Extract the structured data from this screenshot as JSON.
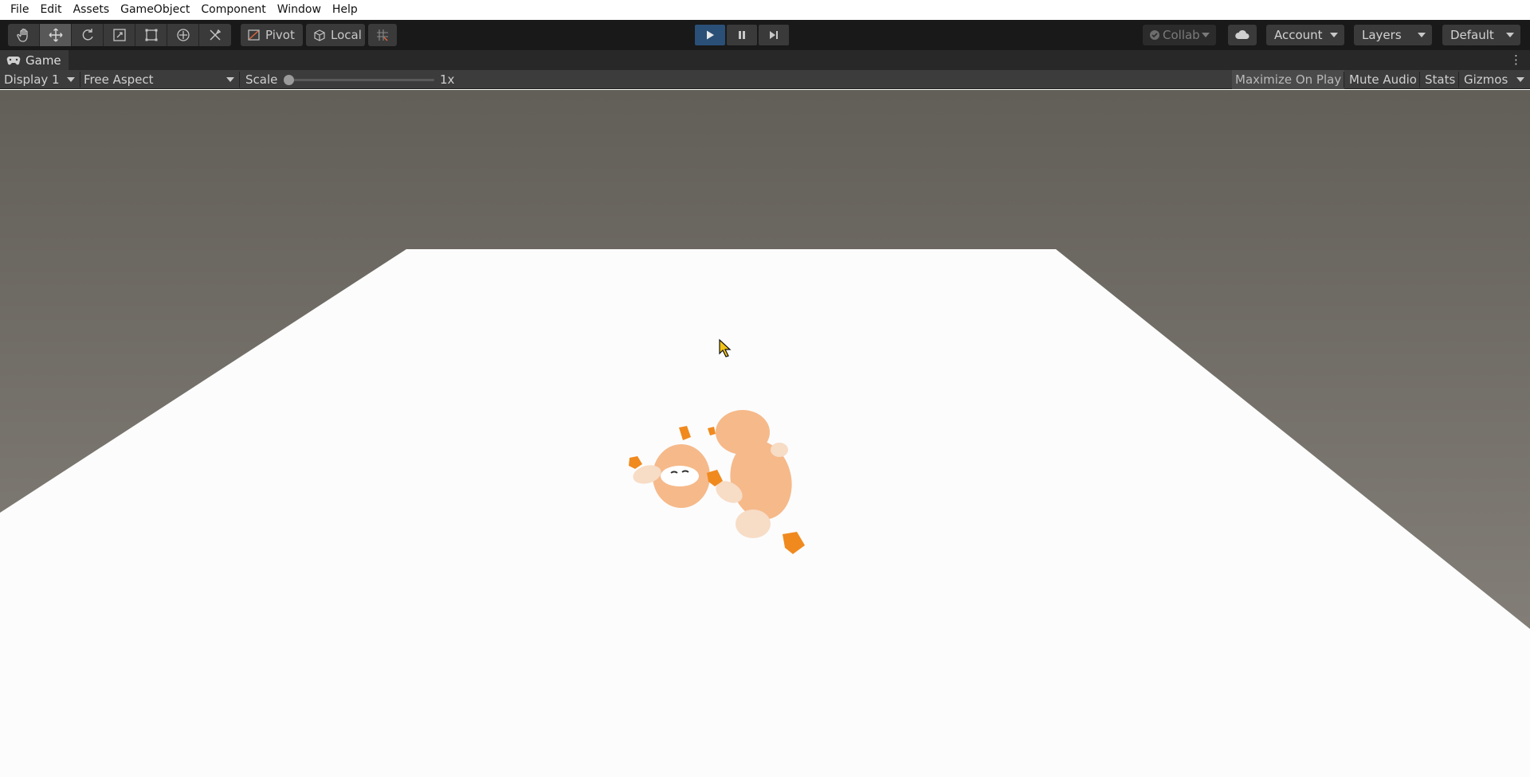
{
  "menu": {
    "items": [
      "File",
      "Edit",
      "Assets",
      "GameObject",
      "Component",
      "Window",
      "Help"
    ]
  },
  "toolbar": {
    "transform_tools": [
      {
        "name": "hand-tool",
        "icon": "hand-icon",
        "active": false
      },
      {
        "name": "move-tool",
        "icon": "move-icon",
        "active": true
      },
      {
        "name": "rotate-tool",
        "icon": "rotate-icon",
        "active": false
      },
      {
        "name": "scale-tool",
        "icon": "scale-icon",
        "active": false
      },
      {
        "name": "rect-tool",
        "icon": "rect-icon",
        "active": false
      },
      {
        "name": "transform-tool",
        "icon": "transform-icon",
        "active": false
      },
      {
        "name": "custom-tool",
        "icon": "tools-icon",
        "active": false
      }
    ],
    "pivot_label": "Pivot",
    "local_label": "Local",
    "play_state": "playing",
    "collab_label": "Collab",
    "account_label": "Account",
    "layers_label": "Layers",
    "layout_label": "Default"
  },
  "tab": {
    "title": "Game"
  },
  "game_bar": {
    "display": "Display 1",
    "aspect": "Free Aspect",
    "scale_label": "Scale",
    "scale_value": "1x",
    "maximize_on_play": "Maximize On Play",
    "mute_audio": "Mute Audio",
    "stats": "Stats",
    "gizmos": "Gizmos"
  },
  "colors": {
    "sky_top": "#625e58",
    "sky_bottom": "#8b8780",
    "ground": "#fcfcfc",
    "character_body": "#f6b98a",
    "character_accent": "#f08a1f",
    "play_active": "#2a5078"
  }
}
